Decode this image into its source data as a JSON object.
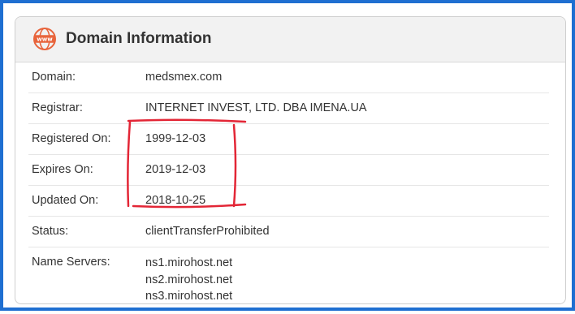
{
  "header": {
    "icon": "www-globe-icon",
    "icon_text": "www",
    "title": "Domain Information"
  },
  "rows": [
    {
      "label": "Domain:",
      "value": "medsmex.com"
    },
    {
      "label": "Registrar:",
      "value": "INTERNET INVEST, LTD. DBA IMENA.UA"
    },
    {
      "label": "Registered On:",
      "value": "1999-12-03"
    },
    {
      "label": "Expires On:",
      "value": "2019-12-03"
    },
    {
      "label": "Updated On:",
      "value": "2018-10-25"
    },
    {
      "label": "Status:",
      "value": "clientTransferProhibited"
    }
  ],
  "name_servers": {
    "label": "Name Servers:",
    "values": [
      "ns1.mirohost.net",
      "ns2.mirohost.net",
      "ns3.mirohost.net"
    ]
  },
  "colors": {
    "frame": "#1f6fd1",
    "icon_accent": "#e8643c",
    "annotation": "#e32636"
  }
}
